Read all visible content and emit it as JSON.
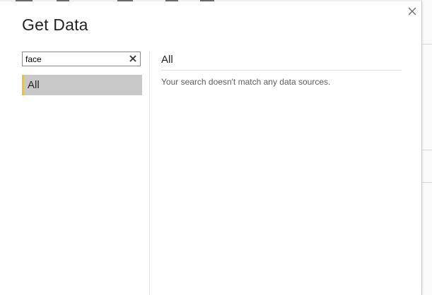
{
  "dialog": {
    "title": "Get Data"
  },
  "search": {
    "value": "face",
    "placeholder": ""
  },
  "categories": [
    {
      "label": "All",
      "selected": true
    }
  ],
  "results": {
    "section_title": "All",
    "empty_message": "Your search doesn't match any data sources."
  },
  "colors": {
    "selected_item_bg": "#c8c8c8",
    "selected_item_accent": "#f2c811",
    "title_text": "#252423",
    "secondary_text": "#605e5c"
  },
  "icons": {
    "close": "close-icon",
    "clear_search": "clear-search-icon"
  }
}
